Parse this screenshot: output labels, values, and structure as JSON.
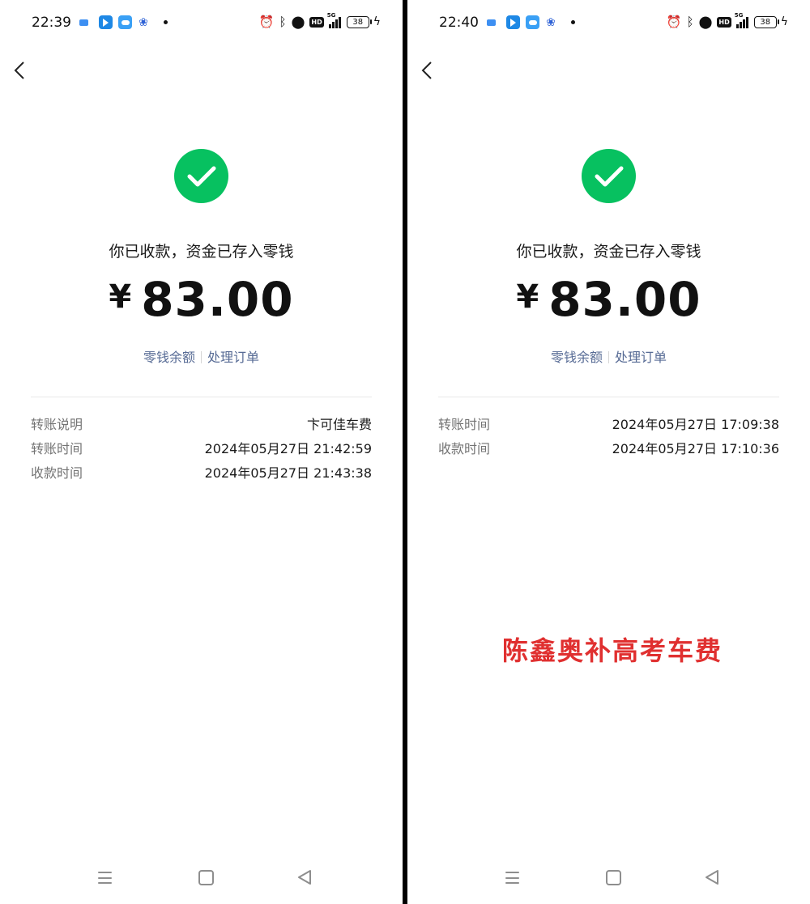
{
  "left_screen": {
    "status_bar": {
      "time": "22:39",
      "battery": "38"
    },
    "receive_message": "你已收款，资金已存入零钱",
    "amount": {
      "currency": "¥",
      "value": "83.00"
    },
    "links": {
      "balance": "零钱余额",
      "orders": "处理订单"
    },
    "details": [
      {
        "label": "转账说明",
        "value": "卞可佳车费"
      },
      {
        "label": "转账时间",
        "value": "2024年05月27日 21:42:59"
      },
      {
        "label": "收款时间",
        "value": "2024年05月27日 21:43:38"
      }
    ]
  },
  "right_screen": {
    "status_bar": {
      "time": "22:40",
      "battery": "38"
    },
    "receive_message": "你已收款，资金已存入零钱",
    "amount": {
      "currency": "¥",
      "value": "83.00"
    },
    "links": {
      "balance": "零钱余额",
      "orders": "处理订单"
    },
    "details": [
      {
        "label": "转账时间",
        "value": "2024年05月27日 17:09:38"
      },
      {
        "label": "收款时间",
        "value": "2024年05月27日 17:10:36"
      }
    ],
    "annotation": "陈鑫奥补高考车费"
  },
  "icons": {
    "status_left": [
      "message-icon",
      "map-app-icon",
      "weather-icon",
      "baidu-paw-icon",
      "notification-dot-icon"
    ],
    "status_right": [
      "alarm-icon",
      "bluetooth-icon",
      "location-icon",
      "hd-icon",
      "signal-5g-icon",
      "battery-icon",
      "charging-icon"
    ],
    "nav": [
      "menu-icon",
      "home-icon",
      "back-icon"
    ]
  },
  "colors": {
    "success_green": "#07c160",
    "link_blue": "#576b95",
    "annotation_red": "#e03030"
  }
}
